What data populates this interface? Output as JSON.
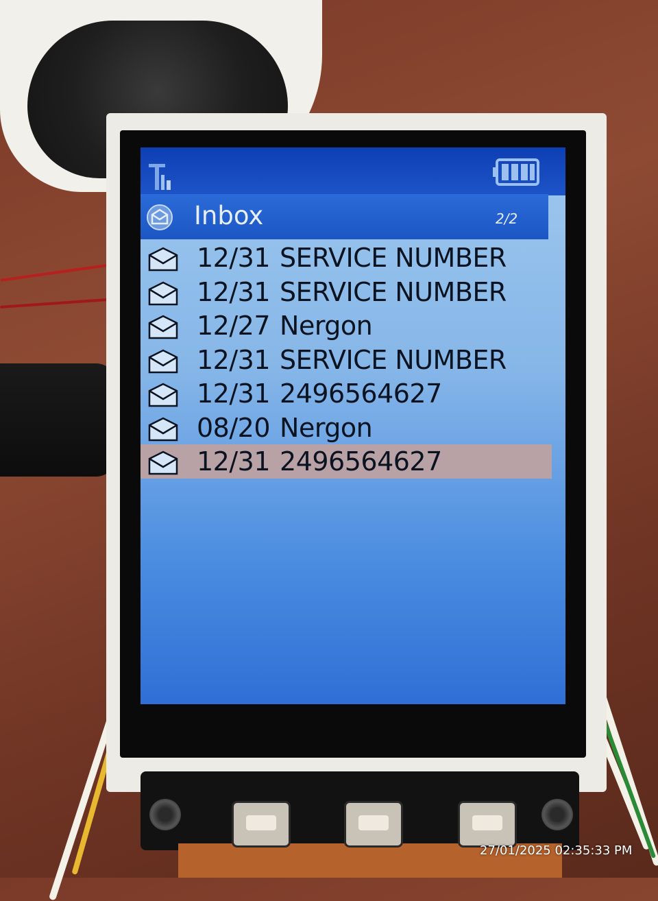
{
  "status_bar": {
    "signal_icon": "signal-icon",
    "battery_icon": "battery-full-icon"
  },
  "title_bar": {
    "icon": "inbox-icon",
    "title": "Inbox",
    "page_indicator": "2/2"
  },
  "messages": [
    {
      "date": "12/31",
      "sender": "SERVICE NUMBER",
      "icon": "envelope-icon",
      "selected": false
    },
    {
      "date": "12/31",
      "sender": "SERVICE NUMBER",
      "icon": "envelope-icon",
      "selected": false
    },
    {
      "date": "12/27",
      "sender": "Nergon",
      "icon": "envelope-icon",
      "selected": false
    },
    {
      "date": "12/31",
      "sender": "SERVICE NUMBER",
      "icon": "envelope-icon",
      "selected": false
    },
    {
      "date": "12/31",
      "sender": "2496564627",
      "icon": "envelope-icon",
      "selected": false
    },
    {
      "date": "08/20",
      "sender": "Nergon",
      "icon": "envelope-icon",
      "selected": false
    },
    {
      "date": "12/31",
      "sender": "2496564627",
      "icon": "envelope-icon",
      "selected": true
    }
  ],
  "colors": {
    "status_bar": "#0d3fb3",
    "title_bar": "#1c56c4",
    "list_background": "#9ec8ee",
    "selected_row": "#b8a2a6",
    "text": "#0b1320"
  },
  "photo_timestamp": "27/01/2025 02:35:33 PM"
}
